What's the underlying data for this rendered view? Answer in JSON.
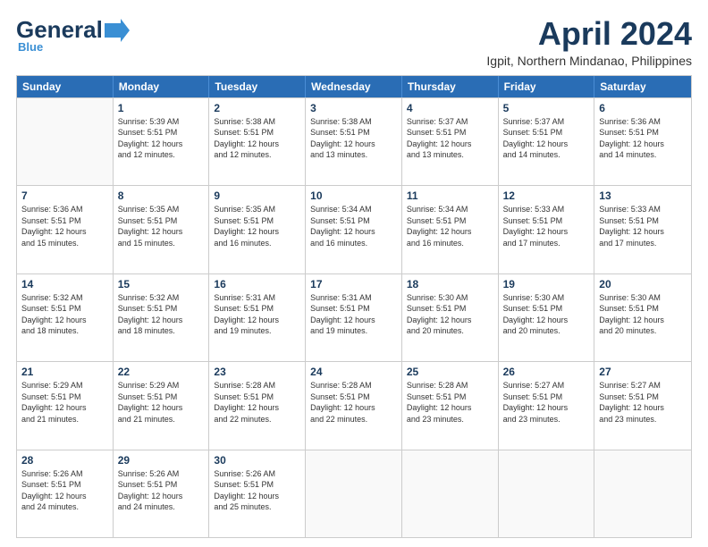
{
  "header": {
    "logo_general": "General",
    "logo_blue": "Blue",
    "title": "April 2024",
    "subtitle": "Igpit, Northern Mindanao, Philippines"
  },
  "calendar": {
    "days": [
      "Sunday",
      "Monday",
      "Tuesday",
      "Wednesday",
      "Thursday",
      "Friday",
      "Saturday"
    ],
    "rows": [
      [
        {
          "day": "",
          "info": ""
        },
        {
          "day": "1",
          "info": "Sunrise: 5:39 AM\nSunset: 5:51 PM\nDaylight: 12 hours\nand 12 minutes."
        },
        {
          "day": "2",
          "info": "Sunrise: 5:38 AM\nSunset: 5:51 PM\nDaylight: 12 hours\nand 12 minutes."
        },
        {
          "day": "3",
          "info": "Sunrise: 5:38 AM\nSunset: 5:51 PM\nDaylight: 12 hours\nand 13 minutes."
        },
        {
          "day": "4",
          "info": "Sunrise: 5:37 AM\nSunset: 5:51 PM\nDaylight: 12 hours\nand 13 minutes."
        },
        {
          "day": "5",
          "info": "Sunrise: 5:37 AM\nSunset: 5:51 PM\nDaylight: 12 hours\nand 14 minutes."
        },
        {
          "day": "6",
          "info": "Sunrise: 5:36 AM\nSunset: 5:51 PM\nDaylight: 12 hours\nand 14 minutes."
        }
      ],
      [
        {
          "day": "7",
          "info": "Sunrise: 5:36 AM\nSunset: 5:51 PM\nDaylight: 12 hours\nand 15 minutes."
        },
        {
          "day": "8",
          "info": "Sunrise: 5:35 AM\nSunset: 5:51 PM\nDaylight: 12 hours\nand 15 minutes."
        },
        {
          "day": "9",
          "info": "Sunrise: 5:35 AM\nSunset: 5:51 PM\nDaylight: 12 hours\nand 16 minutes."
        },
        {
          "day": "10",
          "info": "Sunrise: 5:34 AM\nSunset: 5:51 PM\nDaylight: 12 hours\nand 16 minutes."
        },
        {
          "day": "11",
          "info": "Sunrise: 5:34 AM\nSunset: 5:51 PM\nDaylight: 12 hours\nand 16 minutes."
        },
        {
          "day": "12",
          "info": "Sunrise: 5:33 AM\nSunset: 5:51 PM\nDaylight: 12 hours\nand 17 minutes."
        },
        {
          "day": "13",
          "info": "Sunrise: 5:33 AM\nSunset: 5:51 PM\nDaylight: 12 hours\nand 17 minutes."
        }
      ],
      [
        {
          "day": "14",
          "info": "Sunrise: 5:32 AM\nSunset: 5:51 PM\nDaylight: 12 hours\nand 18 minutes."
        },
        {
          "day": "15",
          "info": "Sunrise: 5:32 AM\nSunset: 5:51 PM\nDaylight: 12 hours\nand 18 minutes."
        },
        {
          "day": "16",
          "info": "Sunrise: 5:31 AM\nSunset: 5:51 PM\nDaylight: 12 hours\nand 19 minutes."
        },
        {
          "day": "17",
          "info": "Sunrise: 5:31 AM\nSunset: 5:51 PM\nDaylight: 12 hours\nand 19 minutes."
        },
        {
          "day": "18",
          "info": "Sunrise: 5:30 AM\nSunset: 5:51 PM\nDaylight: 12 hours\nand 20 minutes."
        },
        {
          "day": "19",
          "info": "Sunrise: 5:30 AM\nSunset: 5:51 PM\nDaylight: 12 hours\nand 20 minutes."
        },
        {
          "day": "20",
          "info": "Sunrise: 5:30 AM\nSunset: 5:51 PM\nDaylight: 12 hours\nand 20 minutes."
        }
      ],
      [
        {
          "day": "21",
          "info": "Sunrise: 5:29 AM\nSunset: 5:51 PM\nDaylight: 12 hours\nand 21 minutes."
        },
        {
          "day": "22",
          "info": "Sunrise: 5:29 AM\nSunset: 5:51 PM\nDaylight: 12 hours\nand 21 minutes."
        },
        {
          "day": "23",
          "info": "Sunrise: 5:28 AM\nSunset: 5:51 PM\nDaylight: 12 hours\nand 22 minutes."
        },
        {
          "day": "24",
          "info": "Sunrise: 5:28 AM\nSunset: 5:51 PM\nDaylight: 12 hours\nand 22 minutes."
        },
        {
          "day": "25",
          "info": "Sunrise: 5:28 AM\nSunset: 5:51 PM\nDaylight: 12 hours\nand 23 minutes."
        },
        {
          "day": "26",
          "info": "Sunrise: 5:27 AM\nSunset: 5:51 PM\nDaylight: 12 hours\nand 23 minutes."
        },
        {
          "day": "27",
          "info": "Sunrise: 5:27 AM\nSunset: 5:51 PM\nDaylight: 12 hours\nand 23 minutes."
        }
      ],
      [
        {
          "day": "28",
          "info": "Sunrise: 5:26 AM\nSunset: 5:51 PM\nDaylight: 12 hours\nand 24 minutes."
        },
        {
          "day": "29",
          "info": "Sunrise: 5:26 AM\nSunset: 5:51 PM\nDaylight: 12 hours\nand 24 minutes."
        },
        {
          "day": "30",
          "info": "Sunrise: 5:26 AM\nSunset: 5:51 PM\nDaylight: 12 hours\nand 25 minutes."
        },
        {
          "day": "",
          "info": ""
        },
        {
          "day": "",
          "info": ""
        },
        {
          "day": "",
          "info": ""
        },
        {
          "day": "",
          "info": ""
        }
      ]
    ]
  }
}
